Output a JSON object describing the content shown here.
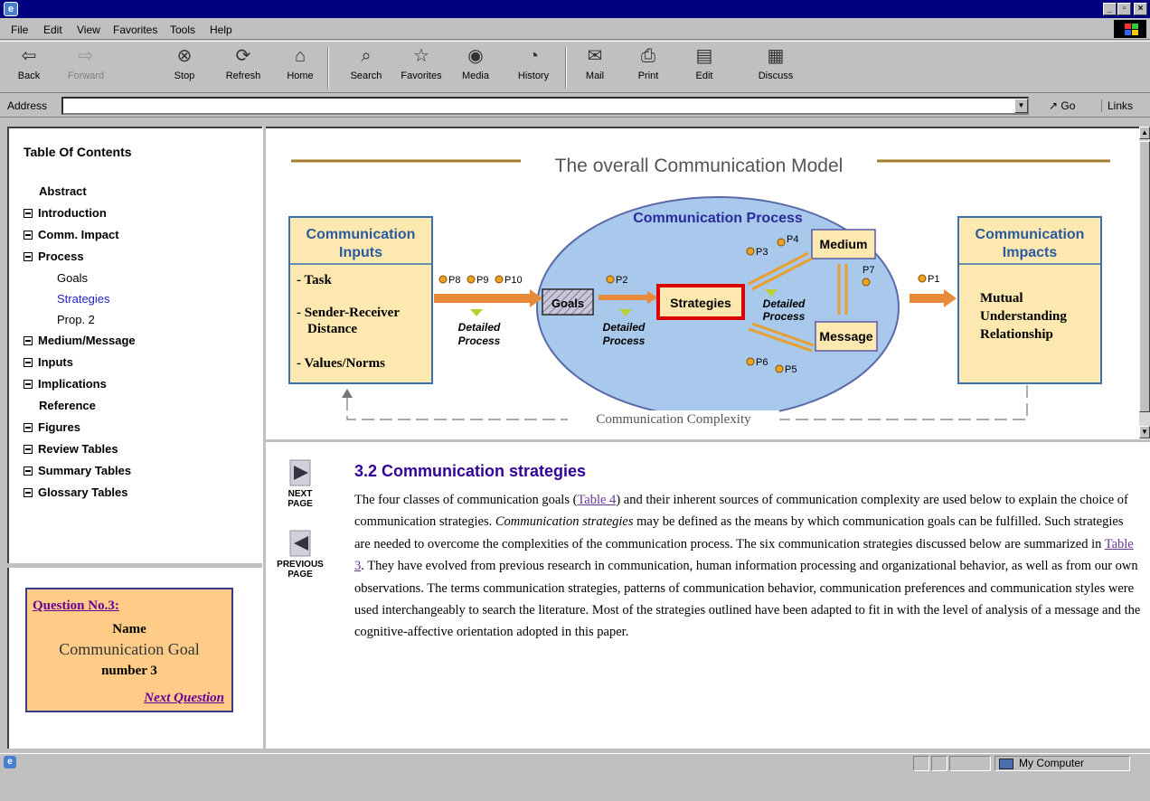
{
  "window": {
    "min": "_",
    "max": "▫",
    "close": "×"
  },
  "menu": [
    "File",
    "Edit",
    "View",
    "Favorites",
    "Tools",
    "Help"
  ],
  "toolbar": {
    "back": "Back",
    "forward": "Forward",
    "stop": "Stop",
    "refresh": "Refresh",
    "home": "Home",
    "search": "Search",
    "favorites": "Favorites",
    "media": "Media",
    "history": "History",
    "mail": "Mail",
    "print": "Print",
    "edit": "Edit",
    "discuss": "Discuss"
  },
  "address": {
    "label": "Address",
    "value": "",
    "go": "Go",
    "links": "Links"
  },
  "toc": {
    "title": "Table Of Contents",
    "items": [
      {
        "label": "Abstract",
        "icon": false
      },
      {
        "label": "Introduction",
        "icon": true
      },
      {
        "label": "Comm. Impact",
        "icon": true
      },
      {
        "label": "Process",
        "icon": true
      },
      {
        "label": "Goals",
        "sub": true
      },
      {
        "label": "Strategies",
        "sub": true,
        "active": true
      },
      {
        "label": "Prop. 2",
        "sub": true
      },
      {
        "label": "Medium/Message",
        "icon": true
      },
      {
        "label": "Inputs",
        "icon": true
      },
      {
        "label": "Implications",
        "icon": true
      },
      {
        "label": "Reference",
        "icon": false
      },
      {
        "label": "Figures",
        "icon": true
      },
      {
        "label": "Review Tables",
        "icon": true
      },
      {
        "label": "Summary Tables",
        "icon": true
      },
      {
        "label": "Glossary Tables",
        "icon": true
      }
    ]
  },
  "question": {
    "title": "Question No.3:",
    "name": "Name",
    "goal": "Communication Goal",
    "number": "number 3",
    "next": "Next Question"
  },
  "diagram": {
    "title": "The overall Communication Model",
    "inputs_title": "Communication Inputs",
    "inputs": [
      "- Task",
      "- Sender-Receiver Distance",
      "- Values/Norms"
    ],
    "process_title": "Communication Process",
    "goals": "Goals",
    "strategies": "Strategies",
    "medium": "Medium",
    "message": "Message",
    "detailed": "Detailed",
    "process": "Process",
    "impacts_title": "Communication Impacts",
    "impacts": [
      "Mutual",
      "Understanding",
      "Relationship"
    ],
    "complexity": "Communication Complexity",
    "p1": "P1",
    "p2": "P2",
    "p3": "P3",
    "p4": "P4",
    "p5": "P5",
    "p6": "P6",
    "p7": "P7",
    "p8": "P8",
    "p9": "P9",
    "p10": "P10"
  },
  "nav": {
    "next": "NEXT PAGE",
    "prev": "PREVIOUS PAGE"
  },
  "section": {
    "heading": "3.2 Communication strategies",
    "p1": " The four classes of communication goals (",
    "link1": "Table 4",
    "p2": ") and their inherent sources of communication complexity are used below to explain the choice of communication strategies. ",
    "em": "Communication strategies",
    "p3": " may be defined as the means by which communication goals can be fulfilled. Such strategies are needed to overcome the complexities of the communication process. The six communication strategies discussed below are summarized in ",
    "link2": "Table 3",
    "p4": ". They have evolved from previous research in communication, human information processing and organizational behavior, as well as from our own observations. The terms communication strategies, patterns of communication behavior, communication preferences and communication styles were used interchangeably to search the literature. Most of the strategies outlined have been adapted to fit in with the level of analysis of a message and the cognitive-affective orientation adopted in this paper."
  },
  "status": {
    "zone": "My Computer"
  }
}
